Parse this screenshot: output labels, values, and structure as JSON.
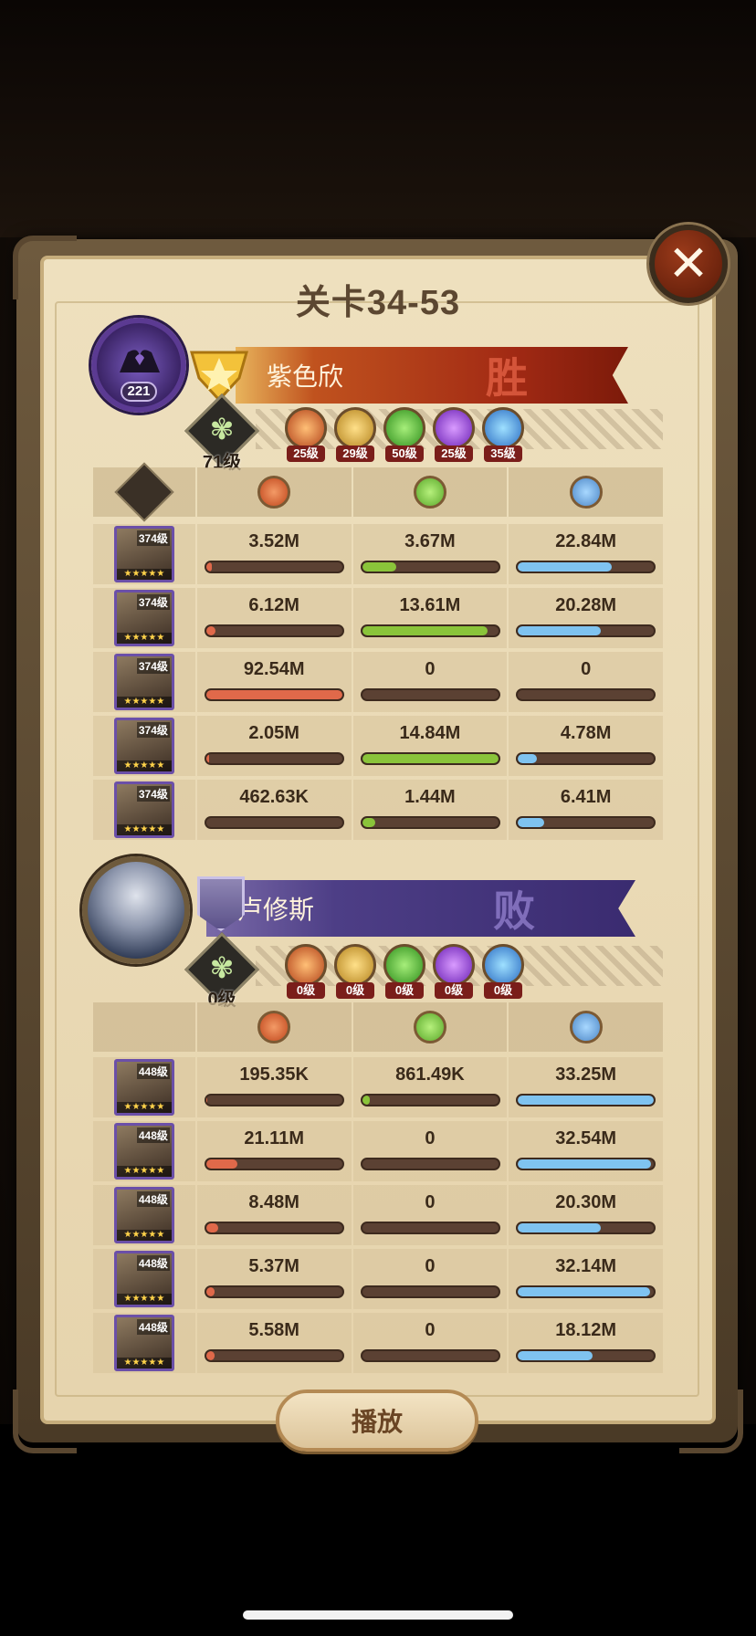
{
  "title": "关卡34-53",
  "team1": {
    "name": "紫色欣",
    "result": "胜",
    "avatar_level": "221",
    "tree_level": "71级",
    "factions": [
      {
        "type": "lightbearer",
        "level": "25级"
      },
      {
        "type": "mauler",
        "level": "29级"
      },
      {
        "type": "wilder",
        "level": "50级"
      },
      {
        "type": "graveborn",
        "level": "25级"
      },
      {
        "type": "celestial",
        "level": "35级"
      }
    ],
    "columns": [
      "damage-icon",
      "heal-icon",
      "defense-icon"
    ],
    "heroes": [
      {
        "level": "374级",
        "stars": "★★★★★",
        "damage": "3.52M",
        "heal": "3.67M",
        "defense": "22.84M",
        "damage_ratio": 0.04,
        "heal_ratio": 0.25,
        "defense_ratio": 0.69
      },
      {
        "level": "374级",
        "stars": "★★★★★",
        "damage": "6.12M",
        "heal": "13.61M",
        "defense": "20.28M",
        "damage_ratio": 0.07,
        "heal_ratio": 0.92,
        "defense_ratio": 0.61
      },
      {
        "level": "374级",
        "stars": "★★★★★",
        "damage": "92.54M",
        "heal": "0",
        "defense": "0",
        "damage_ratio": 1.0,
        "heal_ratio": 0.0,
        "defense_ratio": 0.0
      },
      {
        "level": "374级",
        "stars": "★★★★★",
        "damage": "2.05M",
        "heal": "14.84M",
        "defense": "4.78M",
        "damage_ratio": 0.02,
        "heal_ratio": 1.0,
        "defense_ratio": 0.14
      },
      {
        "level": "374级",
        "stars": "★★★★★",
        "damage": "462.63K",
        "heal": "1.44M",
        "defense": "6.41M",
        "damage_ratio": 0.0,
        "heal_ratio": 0.1,
        "defense_ratio": 0.19
      }
    ]
  },
  "team2": {
    "name": "卢修斯",
    "result": "败",
    "tree_level": "0级",
    "factions": [
      {
        "type": "lightbearer",
        "level": "0级"
      },
      {
        "type": "mauler",
        "level": "0级"
      },
      {
        "type": "wilder",
        "level": "0级"
      },
      {
        "type": "graveborn",
        "level": "0级"
      },
      {
        "type": "celestial",
        "level": "0级"
      }
    ],
    "columns": [
      "damage-icon",
      "heal-icon",
      "defense-icon"
    ],
    "heroes": [
      {
        "level": "448级",
        "stars": "★★★★★",
        "damage": "195.35K",
        "heal": "861.49K",
        "defense": "33.25M",
        "damage_ratio": 0.01,
        "heal_ratio": 0.06,
        "defense_ratio": 1.0
      },
      {
        "level": "448级",
        "stars": "★★★★★",
        "damage": "21.11M",
        "heal": "0",
        "defense": "32.54M",
        "damage_ratio": 0.23,
        "heal_ratio": 0.0,
        "defense_ratio": 0.98
      },
      {
        "level": "448级",
        "stars": "★★★★★",
        "damage": "8.48M",
        "heal": "0",
        "defense": "20.30M",
        "damage_ratio": 0.09,
        "heal_ratio": 0.0,
        "defense_ratio": 0.61
      },
      {
        "level": "448级",
        "stars": "★★★★★",
        "damage": "5.37M",
        "heal": "0",
        "defense": "32.14M",
        "damage_ratio": 0.06,
        "heal_ratio": 0.0,
        "defense_ratio": 0.97
      },
      {
        "level": "448级",
        "stars": "★★★★★",
        "damage": "5.58M",
        "heal": "0",
        "defense": "18.12M",
        "damage_ratio": 0.06,
        "heal_ratio": 0.0,
        "defense_ratio": 0.55
      }
    ]
  },
  "play_label": "播放",
  "close_symbol": "✕"
}
